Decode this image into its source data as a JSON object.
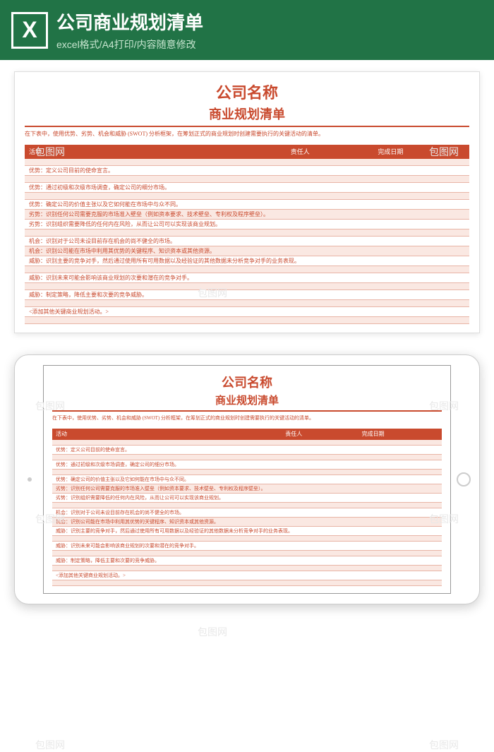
{
  "header": {
    "title": "公司商业规划清单",
    "subtitle": "excel格式/A4打印/内容随意修改"
  },
  "watermark_text": "包图网",
  "sheet": {
    "company_name": "公司名称",
    "title": "商业规划清单",
    "subtitle": "在下表中，使用优势、劣势、机会和威胁 (SWOT) 分析框架，在筹划正式的商业规划时创建需要执行的关键活动的清单。",
    "columns": {
      "activity": "活动",
      "person": "责任人",
      "date": "完成日期"
    },
    "rows": [
      "优势：定义公司目前的使命宣言。",
      "优势：通过初级和次级市场调查，确定公司的细分市场。",
      "优势：确定公司的价值主张以及它如何能在市场中与众不同。",
      "劣势：识别任何公司需要克服的市场准入壁垒（例如资本要求、技术壁垒、专利权及程序壁垒）。",
      "劣势：识别组织需要降低的任何内在风险，从而让公司可以实现该商业规划。",
      "机会：识别对于公司未设目前存在机会的尚不健全的市场。",
      "机会：识别公司能在市场中利用其优势的关键程序、知识资本或其他资源。",
      "威胁：识别主要的竞争对手，然后通过使用所有可用数据以及经验证的其他数据未分析竞争对手的业务表现。",
      "威胁：识别未来可能会影响该商业规划的次要和潜在的竞争对手。",
      "威胁：制定策略，降低主要和次要的竞争威胁。",
      "<添加其他关键商业规划活动。>"
    ]
  }
}
